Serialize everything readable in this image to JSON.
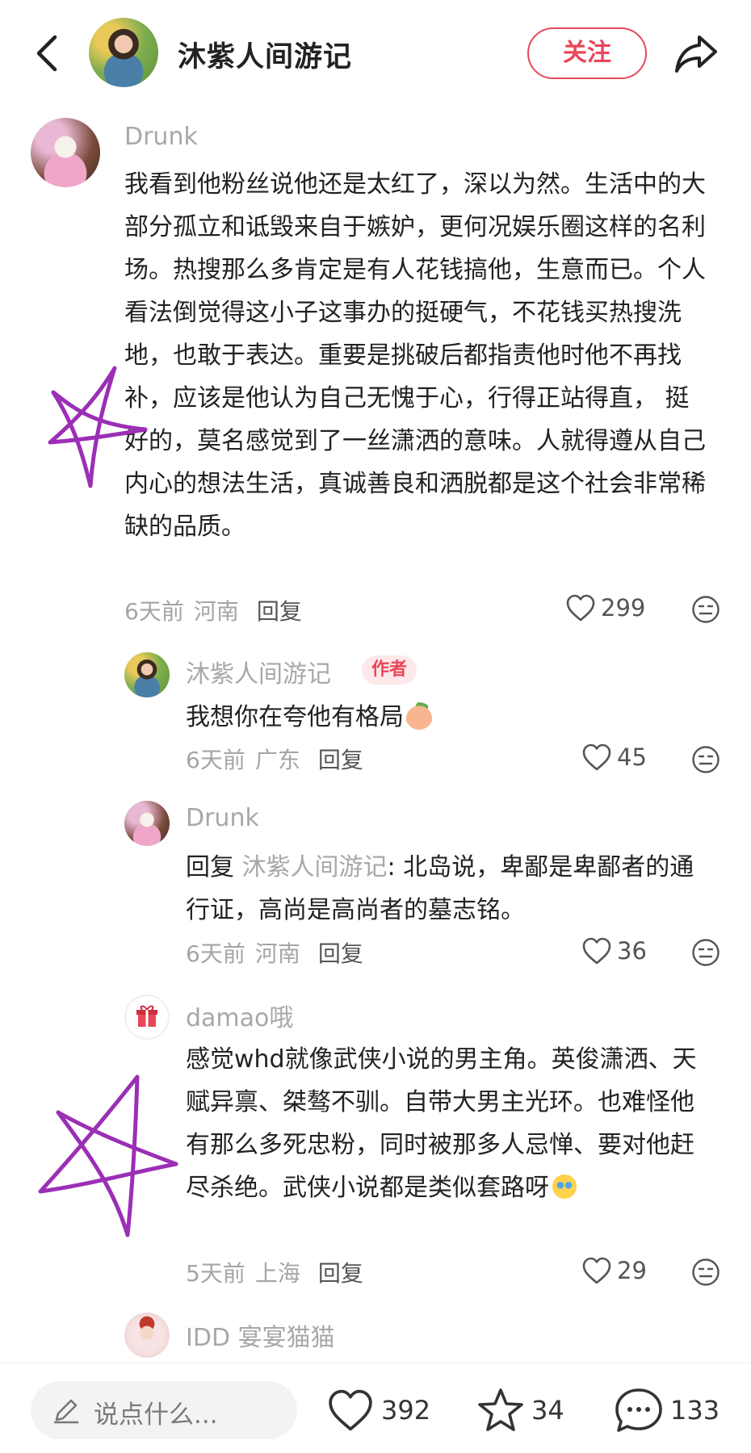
{
  "header": {
    "title": "沐紫人间游记",
    "follow_label": "关注",
    "back_icon": "chevron-left-icon",
    "share_icon": "share-arrow-icon"
  },
  "comments": [
    {
      "username": "Drunk",
      "text": "我看到他粉丝说他还是太红了，深以为然。生活中的大部分孤立和诋毁来自于嫉妒，更何况娱乐圈这样的名利场。热搜那么多肯定是有人花钱搞他，生意而已。个人看法倒觉得这小子这事办的挺硬气，不花钱买热搜洗地，也敢于表达。重要是挑破后都指责他时他不再找补，应该是他认为自己无愧于心，行得正站得直， 挺好的，莫名感觉到了一丝潇洒的意味。人就得遵从自己内心的想法生活，真诚善良和洒脱都是这个社会非常稀缺的品质。",
      "time": "6天前",
      "location": "河南",
      "reply_label": "回复",
      "likes": "299"
    },
    {
      "username": "沐紫人间游记",
      "author_tag": "作者",
      "text": "我想你在夸他有格局",
      "time": "6天前",
      "location": "广东",
      "reply_label": "回复",
      "likes": "45"
    },
    {
      "username": "Drunk",
      "reply_prefix": "回复",
      "mention": "沐紫人间游记",
      "text": ": 北岛说，卑鄙是卑鄙者的通行证，高尚是高尚者的墓志铭。",
      "time": "6天前",
      "location": "河南",
      "reply_label": "回复",
      "likes": "36"
    },
    {
      "username": "damao哦",
      "text": "感觉whd就像武侠小说的男主角。英俊潇洒、天赋异禀、桀骜不驯。自带大男主光环。也难怪他有那么多死忠粉，同时被那多人忌惮、要对他赶尽杀绝。武侠小说都是类似套路呀",
      "time": "5天前",
      "location": "上海",
      "reply_label": "回复",
      "likes": "29"
    },
    {
      "username": "IDD 宴宴猫猫"
    }
  ],
  "bottom_bar": {
    "input_placeholder": "说点什么...",
    "likes": "392",
    "stars": "34",
    "comments": "133"
  },
  "colors": {
    "accent": "#e8475b",
    "star_annotation": "#9b2fb5"
  }
}
